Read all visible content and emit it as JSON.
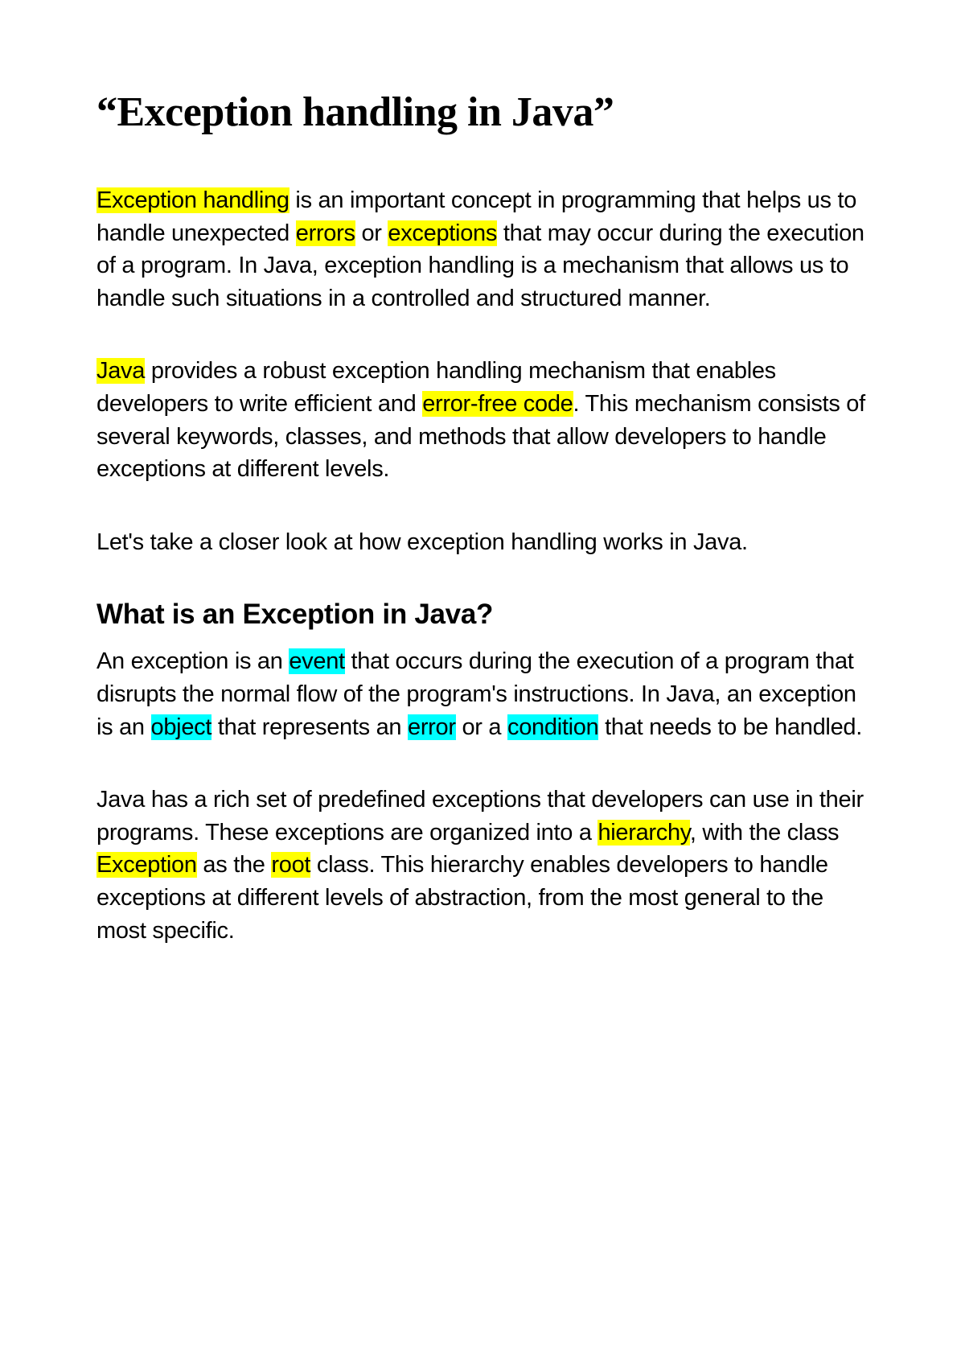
{
  "title": "“Exception handling in Java”",
  "para1": {
    "t1": "Exception handling",
    "t2": " is an important concept in programming that helps us to handle unexpected ",
    "t3": "errors",
    "t4": " or ",
    "t5": "exceptions",
    "t6": " that may occur during the execution of a program. In Java, exception handling is a mechanism that allows us to handle such situations in a controlled and structured manner."
  },
  "para2": {
    "t1": "Java",
    "t2": " provides a robust exception handling mechanism that enables developers to write efficient and ",
    "t3": "error-free code",
    "t4": ". This mechanism consists of several keywords, classes, and methods that allow developers to handle exceptions at different levels."
  },
  "para3": {
    "t1": "Let's take a closer look at how exception handling works in Java."
  },
  "heading2": "What is an Exception in Java?",
  "para4": {
    "t1": "An exception is an ",
    "t2": "event",
    "t3": " that occurs during the execution of a program that disrupts the normal flow of the program's instructions. In Java, an exception is an ",
    "t4": "object",
    "t5": " that represents an ",
    "t6": "error",
    "t7": " or a ",
    "t8": "condition",
    "t9": " that needs to be handled."
  },
  "para5": {
    "t1": "Java has a rich set of predefined exceptions that developers can use in their programs. These exceptions are organized into a ",
    "t2": "hierarchy",
    "t3": ", with the class ",
    "t4": "Exception",
    "t5": " as the ",
    "t6": "root",
    "t7": " class. This hierarchy enables developers to handle exceptions at different levels of abstraction, from the most general to the most specific."
  }
}
